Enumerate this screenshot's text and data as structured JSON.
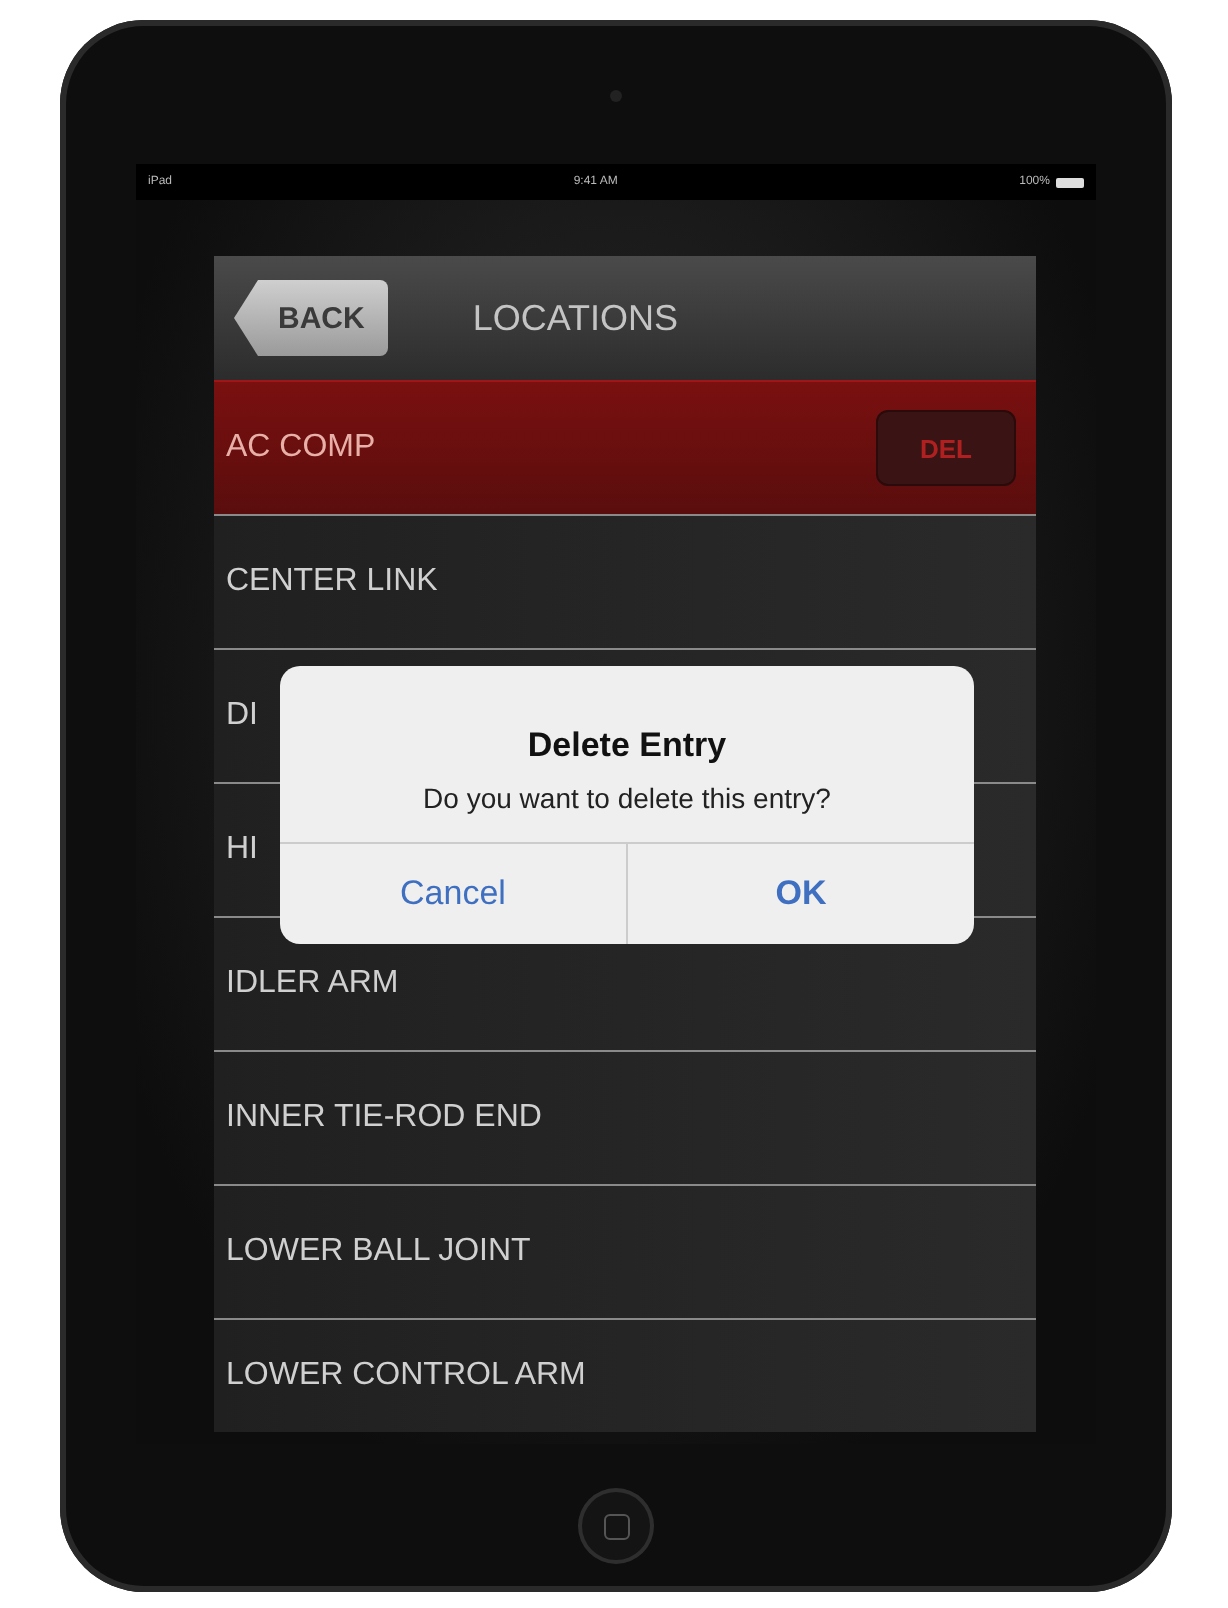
{
  "status_bar": {
    "device": "iPad",
    "time": "9:41 AM",
    "battery": "100%"
  },
  "nav_bar": {
    "back": "BACK",
    "title": "LOCATIONS"
  },
  "rows": [
    {
      "label": "AC COMP",
      "selected": true,
      "action": "DEL"
    },
    {
      "label": "CENTER LINK",
      "selected": false
    },
    {
      "label": "DI",
      "selected": false
    },
    {
      "label": "HI",
      "selected": false
    },
    {
      "label": "IDLER ARM",
      "selected": false
    },
    {
      "label": "INNER TIE-ROD END",
      "selected": false
    },
    {
      "label": "LOWER BALL JOINT",
      "selected": false
    },
    {
      "label": "LOWER CONTROL ARM",
      "selected": false
    }
  ],
  "alert": {
    "title": "Delete Entry",
    "message": "Do you want to delete this entry?",
    "buttons": [
      {
        "label": "Cancel",
        "kind": "cancel"
      },
      {
        "label": "OK",
        "kind": "default"
      }
    ]
  }
}
